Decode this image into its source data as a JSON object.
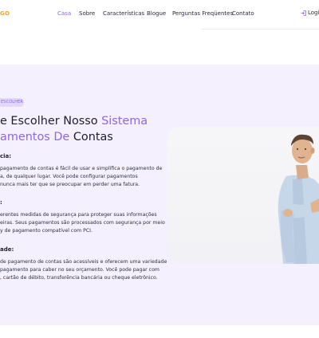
{
  "nav": {
    "logo_fragment": "GO",
    "links": [
      "Casa",
      "Sobre",
      "Características",
      "Blogue",
      "Perguntas Freqüentes",
      "Contato"
    ],
    "active": "Casa",
    "login_label": "Logi"
  },
  "section": {
    "badge": "ESCOLHER",
    "headline_line1_plain": "e Escolher Nosso ",
    "headline_line1_accent": "Sistema",
    "headline_line2_accent": "amentos De",
    "headline_line2_plain": " Contas",
    "items": [
      {
        "title": "cia:",
        "lines": [
          "pagamento de contas é fácil de usar e simplifica o pagamento de",
          "a, de qualquer lugar. Você pode configurar pagamentos",
          "nunca mais ter que se preocupar em perder uma fatura."
        ]
      },
      {
        "title": ":",
        "lines": [
          "erentes medidas de segurança para proteger suas informações",
          "eiras. Seus pagamentos são processados com segurança por meio",
          "y de pagamento compatível com PCI."
        ]
      },
      {
        "title": "ade:",
        "lines": [
          "de pagamento de contas são acessíveis e oferecem uma variedade",
          "pagamento para caber no seu orçamento. Você pode pagar com",
          ", cartão de débito, transferência bancária ou cheque eletrônico."
        ]
      }
    ]
  },
  "colors": {
    "accent": "#9066e2",
    "logo": "#f0a23a",
    "band_bg": "#f4f0fe",
    "badge_bg": "#e2d8fb"
  }
}
